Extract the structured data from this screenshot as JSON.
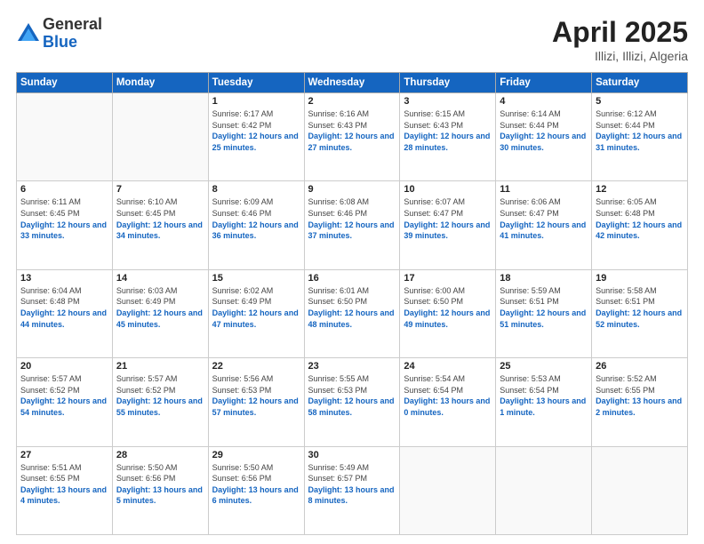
{
  "header": {
    "logo_general": "General",
    "logo_blue": "Blue",
    "title": "April 2025",
    "location": "Illizi, Illizi, Algeria"
  },
  "weekdays": [
    "Sunday",
    "Monday",
    "Tuesday",
    "Wednesday",
    "Thursday",
    "Friday",
    "Saturday"
  ],
  "weeks": [
    [
      {
        "day": "",
        "sunrise": "",
        "sunset": "",
        "daylight": ""
      },
      {
        "day": "",
        "sunrise": "",
        "sunset": "",
        "daylight": ""
      },
      {
        "day": "1",
        "sunrise": "Sunrise: 6:17 AM",
        "sunset": "Sunset: 6:42 PM",
        "daylight": "Daylight: 12 hours and 25 minutes."
      },
      {
        "day": "2",
        "sunrise": "Sunrise: 6:16 AM",
        "sunset": "Sunset: 6:43 PM",
        "daylight": "Daylight: 12 hours and 27 minutes."
      },
      {
        "day": "3",
        "sunrise": "Sunrise: 6:15 AM",
        "sunset": "Sunset: 6:43 PM",
        "daylight": "Daylight: 12 hours and 28 minutes."
      },
      {
        "day": "4",
        "sunrise": "Sunrise: 6:14 AM",
        "sunset": "Sunset: 6:44 PM",
        "daylight": "Daylight: 12 hours and 30 minutes."
      },
      {
        "day": "5",
        "sunrise": "Sunrise: 6:12 AM",
        "sunset": "Sunset: 6:44 PM",
        "daylight": "Daylight: 12 hours and 31 minutes."
      }
    ],
    [
      {
        "day": "6",
        "sunrise": "Sunrise: 6:11 AM",
        "sunset": "Sunset: 6:45 PM",
        "daylight": "Daylight: 12 hours and 33 minutes."
      },
      {
        "day": "7",
        "sunrise": "Sunrise: 6:10 AM",
        "sunset": "Sunset: 6:45 PM",
        "daylight": "Daylight: 12 hours and 34 minutes."
      },
      {
        "day": "8",
        "sunrise": "Sunrise: 6:09 AM",
        "sunset": "Sunset: 6:46 PM",
        "daylight": "Daylight: 12 hours and 36 minutes."
      },
      {
        "day": "9",
        "sunrise": "Sunrise: 6:08 AM",
        "sunset": "Sunset: 6:46 PM",
        "daylight": "Daylight: 12 hours and 37 minutes."
      },
      {
        "day": "10",
        "sunrise": "Sunrise: 6:07 AM",
        "sunset": "Sunset: 6:47 PM",
        "daylight": "Daylight: 12 hours and 39 minutes."
      },
      {
        "day": "11",
        "sunrise": "Sunrise: 6:06 AM",
        "sunset": "Sunset: 6:47 PM",
        "daylight": "Daylight: 12 hours and 41 minutes."
      },
      {
        "day": "12",
        "sunrise": "Sunrise: 6:05 AM",
        "sunset": "Sunset: 6:48 PM",
        "daylight": "Daylight: 12 hours and 42 minutes."
      }
    ],
    [
      {
        "day": "13",
        "sunrise": "Sunrise: 6:04 AM",
        "sunset": "Sunset: 6:48 PM",
        "daylight": "Daylight: 12 hours and 44 minutes."
      },
      {
        "day": "14",
        "sunrise": "Sunrise: 6:03 AM",
        "sunset": "Sunset: 6:49 PM",
        "daylight": "Daylight: 12 hours and 45 minutes."
      },
      {
        "day": "15",
        "sunrise": "Sunrise: 6:02 AM",
        "sunset": "Sunset: 6:49 PM",
        "daylight": "Daylight: 12 hours and 47 minutes."
      },
      {
        "day": "16",
        "sunrise": "Sunrise: 6:01 AM",
        "sunset": "Sunset: 6:50 PM",
        "daylight": "Daylight: 12 hours and 48 minutes."
      },
      {
        "day": "17",
        "sunrise": "Sunrise: 6:00 AM",
        "sunset": "Sunset: 6:50 PM",
        "daylight": "Daylight: 12 hours and 49 minutes."
      },
      {
        "day": "18",
        "sunrise": "Sunrise: 5:59 AM",
        "sunset": "Sunset: 6:51 PM",
        "daylight": "Daylight: 12 hours and 51 minutes."
      },
      {
        "day": "19",
        "sunrise": "Sunrise: 5:58 AM",
        "sunset": "Sunset: 6:51 PM",
        "daylight": "Daylight: 12 hours and 52 minutes."
      }
    ],
    [
      {
        "day": "20",
        "sunrise": "Sunrise: 5:57 AM",
        "sunset": "Sunset: 6:52 PM",
        "daylight": "Daylight: 12 hours and 54 minutes."
      },
      {
        "day": "21",
        "sunrise": "Sunrise: 5:57 AM",
        "sunset": "Sunset: 6:52 PM",
        "daylight": "Daylight: 12 hours and 55 minutes."
      },
      {
        "day": "22",
        "sunrise": "Sunrise: 5:56 AM",
        "sunset": "Sunset: 6:53 PM",
        "daylight": "Daylight: 12 hours and 57 minutes."
      },
      {
        "day": "23",
        "sunrise": "Sunrise: 5:55 AM",
        "sunset": "Sunset: 6:53 PM",
        "daylight": "Daylight: 12 hours and 58 minutes."
      },
      {
        "day": "24",
        "sunrise": "Sunrise: 5:54 AM",
        "sunset": "Sunset: 6:54 PM",
        "daylight": "Daylight: 13 hours and 0 minutes."
      },
      {
        "day": "25",
        "sunrise": "Sunrise: 5:53 AM",
        "sunset": "Sunset: 6:54 PM",
        "daylight": "Daylight: 13 hours and 1 minute."
      },
      {
        "day": "26",
        "sunrise": "Sunrise: 5:52 AM",
        "sunset": "Sunset: 6:55 PM",
        "daylight": "Daylight: 13 hours and 2 minutes."
      }
    ],
    [
      {
        "day": "27",
        "sunrise": "Sunrise: 5:51 AM",
        "sunset": "Sunset: 6:55 PM",
        "daylight": "Daylight: 13 hours and 4 minutes."
      },
      {
        "day": "28",
        "sunrise": "Sunrise: 5:50 AM",
        "sunset": "Sunset: 6:56 PM",
        "daylight": "Daylight: 13 hours and 5 minutes."
      },
      {
        "day": "29",
        "sunrise": "Sunrise: 5:50 AM",
        "sunset": "Sunset: 6:56 PM",
        "daylight": "Daylight: 13 hours and 6 minutes."
      },
      {
        "day": "30",
        "sunrise": "Sunrise: 5:49 AM",
        "sunset": "Sunset: 6:57 PM",
        "daylight": "Daylight: 13 hours and 8 minutes."
      },
      {
        "day": "",
        "sunrise": "",
        "sunset": "",
        "daylight": ""
      },
      {
        "day": "",
        "sunrise": "",
        "sunset": "",
        "daylight": ""
      },
      {
        "day": "",
        "sunrise": "",
        "sunset": "",
        "daylight": ""
      }
    ]
  ]
}
